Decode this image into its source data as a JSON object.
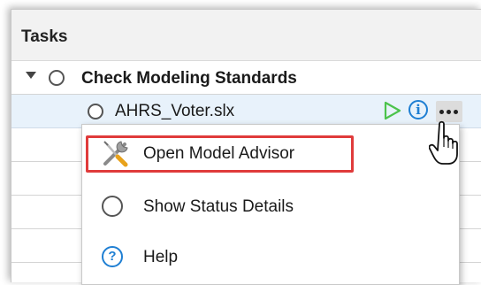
{
  "panel": {
    "header_title": "Tasks"
  },
  "tree": {
    "group": {
      "label": "Check Modeling Standards",
      "expander_icon": "triangle-down-icon",
      "status_icon": "circle-outline-icon"
    },
    "item": {
      "label": "AHRS_Voter.slx",
      "status_icon": "circle-outline-icon",
      "actions": {
        "run_icon": "play-icon",
        "info_icon": "info-icon",
        "info_glyph": "i",
        "more_icon": "ellipsis-icon"
      }
    }
  },
  "context_menu": {
    "items": [
      {
        "label": "Open Model Advisor",
        "icon": "wrench-screwdriver-icon",
        "highlighted": true
      },
      {
        "label": "Show Status Details",
        "icon": "circle-outline-icon",
        "highlighted": false
      },
      {
        "label": "Help",
        "icon": "help-icon",
        "glyph": "?",
        "highlighted": false
      }
    ]
  },
  "colors": {
    "selected_row": "#e8f2fb",
    "run_icon": "#4cc34c",
    "info_icon": "#1f7fd3",
    "highlight_border": "#e03b3b"
  }
}
